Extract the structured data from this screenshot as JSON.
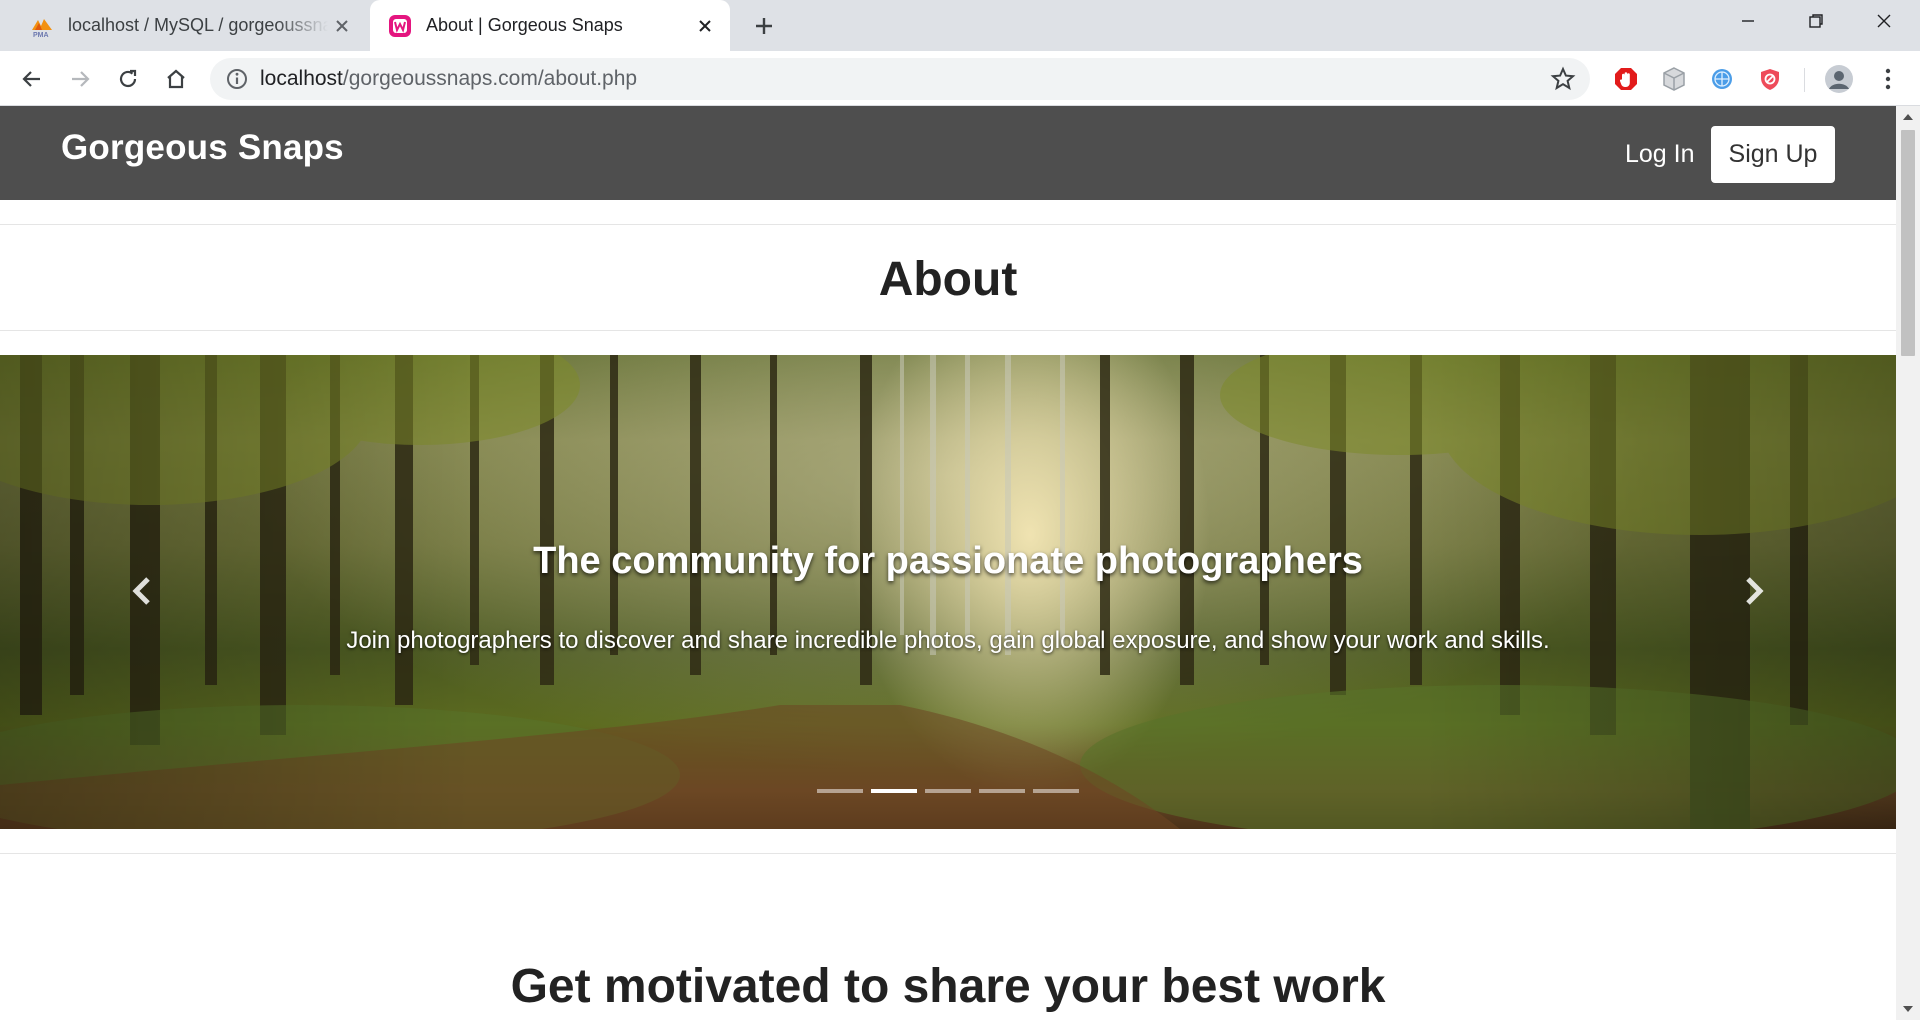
{
  "browser": {
    "tabs": [
      {
        "title": "localhost / MySQL / gorgeoussnaps",
        "active": false,
        "icon": "phpmyadmin-icon"
      },
      {
        "title": "About | Gorgeous Snaps",
        "active": true,
        "icon": "wamp-icon"
      }
    ],
    "url": {
      "host": "localhost",
      "path": "/gorgeoussnaps.com/about.php"
    }
  },
  "site": {
    "brand": "Gorgeous Snaps",
    "nav": {
      "login": "Log In",
      "signup": "Sign Up"
    },
    "about_title": "About",
    "carousel": {
      "heading": "The community for passionate photographers",
      "text": "Join photographers to discover and share incredible photos, gain global exposure, and show your work and skills.",
      "slide_count": 5,
      "active_slide": 2
    },
    "section_title": "Get motivated to share your best work"
  },
  "colors": {
    "navbar": "#4e4e4e",
    "brand_text": "#ffffff",
    "heading_text": "#222222"
  }
}
